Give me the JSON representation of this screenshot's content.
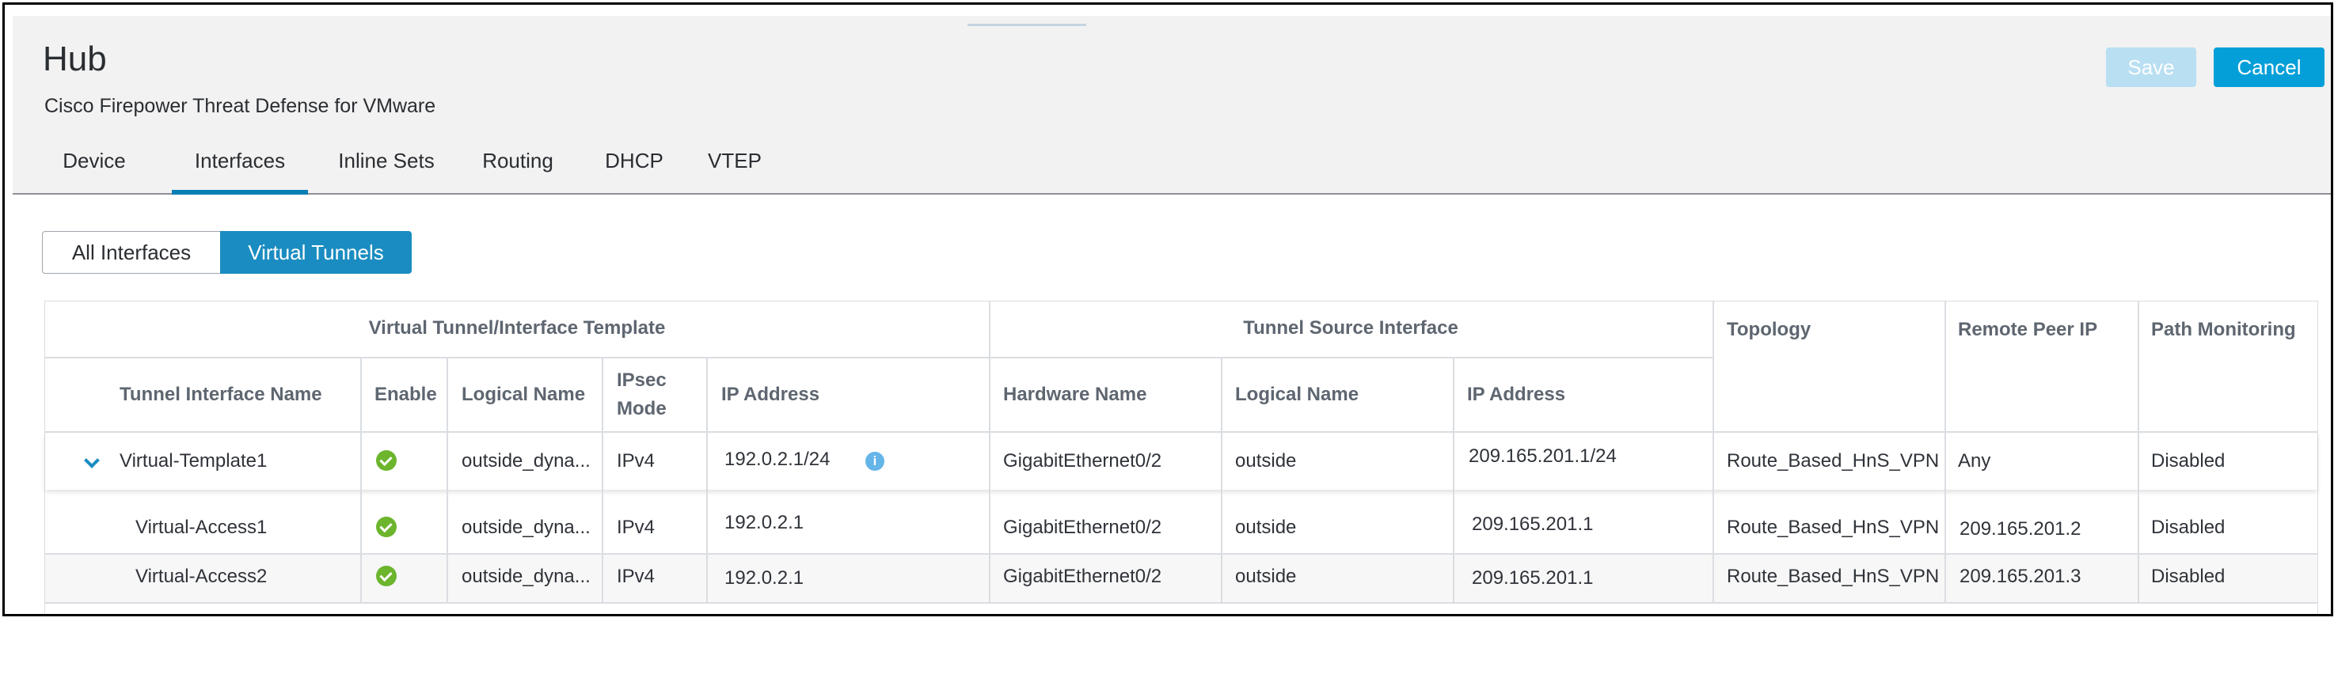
{
  "header": {
    "title": "Hub",
    "subtitle": "Cisco Firepower Threat Defense for VMware",
    "save_label": "Save",
    "cancel_label": "Cancel"
  },
  "tabs": [
    "Device",
    "Interfaces",
    "Inline Sets",
    "Routing",
    "DHCP",
    "VTEP"
  ],
  "active_tab": "Interfaces",
  "view_toggle": {
    "all_label": "All Interfaces",
    "virtual_label": "Virtual Tunnels",
    "selected": "Virtual Tunnels"
  },
  "table": {
    "groups": {
      "virtual_template": "Virtual Tunnel/Interface Template",
      "tunnel_source": "Tunnel Source Interface"
    },
    "columns": {
      "tunnel_name": "Tunnel Interface Name",
      "enable": "Enable",
      "logical_name": "Logical Name",
      "ipsec_mode_line1": "IPsec",
      "ipsec_mode_line2": "Mode",
      "ip_address": "IP Address",
      "hardware_name": "Hardware Name",
      "src_logical_name": "Logical Name",
      "src_ip_address": "IP Address",
      "topology": "Topology",
      "remote_peer_ip": "Remote Peer IP",
      "path_monitoring": "Path Monitoring"
    },
    "rows": [
      {
        "name": "Virtual-Template1",
        "enabled": true,
        "logical": "outside_dyna...",
        "mode": "IPv4",
        "ip": "192.0.2.1/24",
        "hw": "GigabitEthernet0/2",
        "src_logical": "outside",
        "src_ip": "209.165.201.1/24",
        "topology": "Route_Based_HnS_VPN",
        "peer": "Any",
        "monitoring": "Disabled"
      },
      {
        "name": "Virtual-Access1",
        "enabled": true,
        "logical": "outside_dyna...",
        "mode": "IPv4",
        "ip": "192.0.2.1",
        "hw": "GigabitEthernet0/2",
        "src_logical": "outside",
        "src_ip": "209.165.201.1",
        "topology": "Route_Based_HnS_VPN",
        "peer": "209.165.201.2",
        "monitoring": "Disabled"
      },
      {
        "name": "Virtual-Access2",
        "enabled": true,
        "logical": "outside_dyna...",
        "mode": "IPv4",
        "ip": "192.0.2.1",
        "hw": "GigabitEthernet0/2",
        "src_logical": "outside",
        "src_ip": "209.165.201.1",
        "topology": "Route_Based_HnS_VPN",
        "peer": "209.165.201.3",
        "monitoring": "Disabled"
      }
    ]
  },
  "icons": {
    "enabled": "check-circle-icon",
    "info": "info-icon",
    "expand": "chevron-down-icon"
  },
  "colors": {
    "primary": "#049fd9",
    "tab_underline": "#097eb5",
    "enabled_green": "#6cb52d",
    "info_blue": "#64b5e8"
  }
}
